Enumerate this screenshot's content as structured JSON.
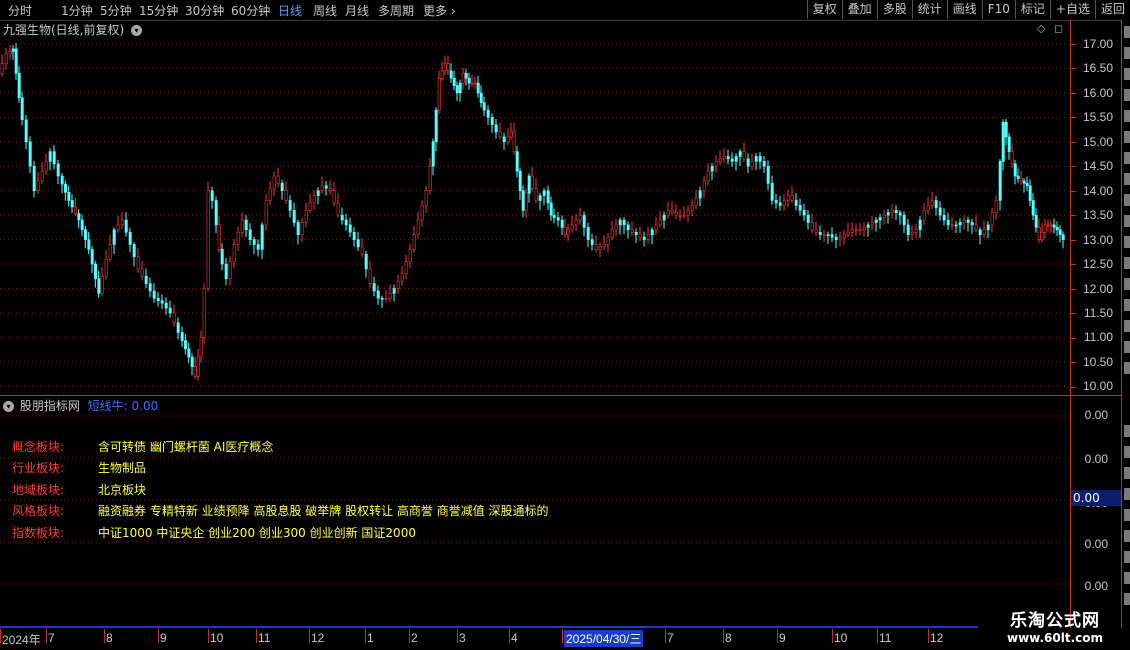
{
  "toolbar": {
    "timeframes": [
      "分时",
      "1分钟",
      "5分钟",
      "15分钟",
      "30分钟",
      "60分钟",
      "日线",
      "周线",
      "月线",
      "多周期",
      "更多 ›"
    ],
    "active_index": 6,
    "buttons": [
      "复权",
      "叠加",
      "多股",
      "统计",
      "画线",
      "F10",
      "标记",
      "+自选",
      "返回"
    ]
  },
  "chart": {
    "title": "九强生物(日线,前复权)",
    "y_ticks": [
      "17.00",
      "16.50",
      "16.00",
      "15.50",
      "15.00",
      "14.50",
      "14.00",
      "13.50",
      "13.00",
      "12.50",
      "12.00",
      "11.50",
      "11.00",
      "10.50",
      "10.00"
    ],
    "up_color": "#ff3232",
    "down_color": "#54ffff"
  },
  "indicator": {
    "name": "股朋指标网",
    "line_label": "短线牛: 0.00",
    "y_ticks": [
      "0.00",
      "0.00",
      "0.00",
      "0.00",
      "0.00"
    ],
    "current_value": "0.00",
    "sectors": [
      {
        "label": "概念板块:",
        "value": "含可转债 幽门螺杆菌 AI医疗概念"
      },
      {
        "label": "行业板块:",
        "value": "生物制品"
      },
      {
        "label": "地域板块:",
        "value": "北京板块"
      },
      {
        "label": "风格板块:",
        "value": "融资融券 专精特新 业绩预降 高股息股 破举牌 股权转让 高商誉 商誉减值 深股通标的"
      },
      {
        "label": "指数板块:",
        "value": "中证1000 中证央企 创业200 创业300 创业创新 国证2000"
      }
    ]
  },
  "date_axis": {
    "labels": [
      "2024年",
      "7",
      "8",
      "9",
      "10",
      "11",
      "12",
      "1",
      "2",
      "3",
      "4",
      "2025/04/30/三",
      "7",
      "8",
      "9",
      "10",
      "11",
      "12"
    ],
    "selected_label": "2025/04/30/三"
  },
  "watermark": {
    "line1": "乐淘公式网",
    "line2": "www.60lt.com"
  }
}
